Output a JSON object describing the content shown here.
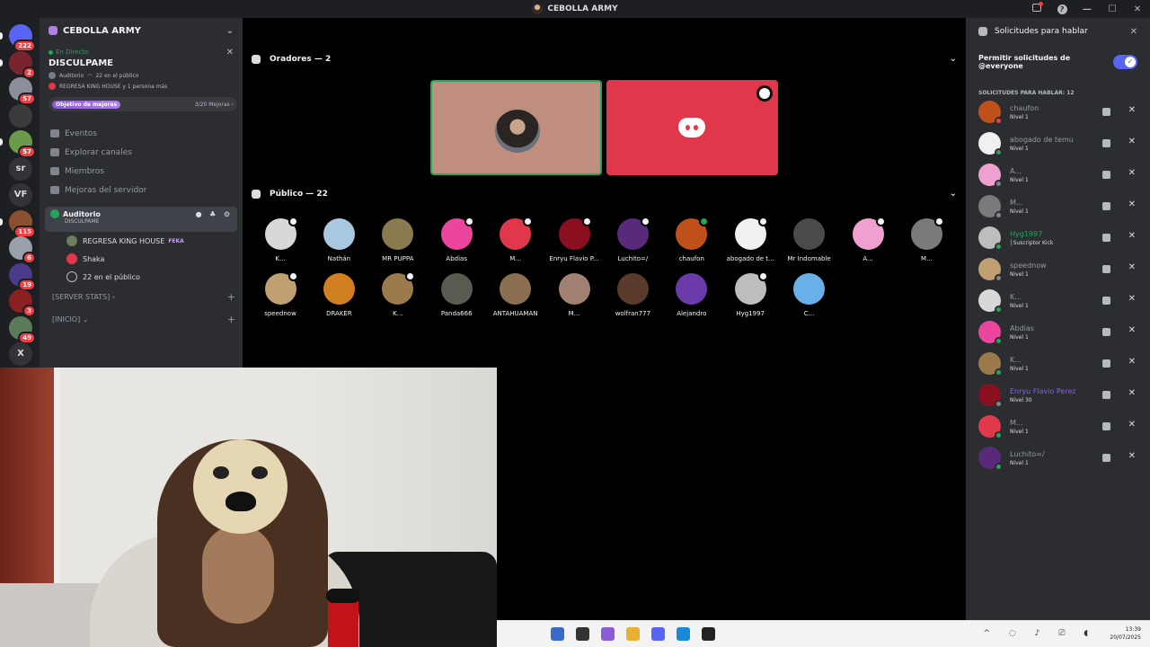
{
  "window": {
    "title": "CEBOLLA ARMY"
  },
  "rail": [
    {
      "badge": "222",
      "color": "#5865f2"
    },
    {
      "badge": "2",
      "color": "#7a2430"
    },
    {
      "badge": "57",
      "color": "#8a8f99"
    },
    {
      "badge": "",
      "color": "#3a3a3a"
    },
    {
      "badge": "57",
      "color": "#6a9a4a"
    },
    {
      "text": "sr"
    },
    {
      "text": "VF"
    },
    {
      "badge": "115",
      "color": "#8a5030"
    },
    {
      "badge": "6",
      "color": "#9aa0aa"
    },
    {
      "badge": "19",
      "color": "#4a3a8a"
    },
    {
      "badge": "3",
      "color": "#8a2020"
    },
    {
      "badge": "49",
      "color": "#5a7a5a"
    },
    {
      "text": "X"
    }
  ],
  "sidebar": {
    "server_name": "CEBOLLA ARMY",
    "live_label": "En Directo",
    "live_title": "DISCULPAME",
    "live_meta1_a": "Auditorio",
    "live_meta1_b": "22 en el público",
    "live_meta2": "REGRESA KING HOUSE y 1 persona más",
    "boost_label": "Objetivo de mejoras",
    "boost_value": "3/20 Mejoras ›",
    "nav": [
      "Eventos",
      "Explorar canales",
      "Miembros",
      "Mejoras del servidor"
    ],
    "voice_channel": {
      "name": "Auditorio",
      "subtitle": "DISCULPAME"
    },
    "voice_members": [
      {
        "name": "REGRESA KING HOUSE",
        "tag": "FEKA"
      },
      {
        "name": "Shaka",
        "tag": ""
      },
      {
        "name": "22 en el público",
        "tag": ""
      }
    ],
    "categories": [
      "[SERVER STATS] ›",
      "[INICIO] ⌄"
    ]
  },
  "stage": {
    "speakers_title": "Oradores — 2",
    "audience_title": "Público — 22",
    "audience": [
      {
        "name": "K...",
        "color": "#d8d8d8",
        "badge": true
      },
      {
        "name": "Nathán",
        "color": "#a8c8e0",
        "badge": false
      },
      {
        "name": "MR PUPPA",
        "color": "#8a7a50",
        "badge": false
      },
      {
        "name": "Abdias",
        "color": "#eb459e",
        "badge": true
      },
      {
        "name": "M...",
        "color": "#e0384a",
        "badge": true
      },
      {
        "name": "Enryu Flavio P...",
        "color": "#8a1020",
        "badge": true
      },
      {
        "name": "Luchito=/",
        "color": "#5a2a7a",
        "badge": true
      },
      {
        "name": "chaufon",
        "color": "#c0501a",
        "badge": "green"
      },
      {
        "name": "abogado de t...",
        "color": "#f0f0f0",
        "badge": true
      },
      {
        "name": "Mr Indomable",
        "color": "#4a4a4a",
        "badge": false
      },
      {
        "name": "A...",
        "color": "#f0a0d0",
        "badge": true
      },
      {
        "name": "M...",
        "color": "#7a7a7a",
        "badge": true
      },
      {
        "name": "speednow",
        "color": "#c0a070",
        "badge": true
      },
      {
        "name": "DRAKER",
        "color": "#d08020",
        "badge": false
      },
      {
        "name": "K...",
        "color": "#9a7a4a",
        "badge": true
      },
      {
        "name": "Panda666",
        "color": "#5a5a50",
        "badge": false
      },
      {
        "name": "ANTAHUAMAN",
        "color": "#8a7050",
        "badge": false
      },
      {
        "name": "M...",
        "color": "#a08070",
        "badge": false
      },
      {
        "name": "wolfran777",
        "color": "#5a3a2a",
        "badge": false
      },
      {
        "name": "Alejandro",
        "color": "#6a3aaa",
        "badge": false
      },
      {
        "name": "Hyg1997",
        "color": "#bdbdbd",
        "badge": true
      },
      {
        "name": "C...",
        "color": "#6ab0e8",
        "badge": false
      }
    ]
  },
  "requests": {
    "title": "Solicitudes para hablar",
    "permit_label": "Permitir solicitudes de @everyone",
    "list_title": "SOLICITUDES PARA HABLAR: 12",
    "items": [
      {
        "name": "chaufon",
        "level": "Nivel 1",
        "color": "#c0501a",
        "status": "dnd"
      },
      {
        "name": "abogado de temu",
        "level": "Nivel 1",
        "color": "#f0f0f0",
        "status": "on"
      },
      {
        "name": "A...",
        "level": "Nivel 1",
        "color": "#f0a0d0",
        "status": "off"
      },
      {
        "name": "M...",
        "level": "Nivel 1",
        "color": "#7a7a7a",
        "status": "off"
      },
      {
        "name": "Hyg1997",
        "level": "│Suscriptor Kick",
        "color": "#bdbdbd",
        "status": "on",
        "nameColor": "#23a55a"
      },
      {
        "name": "speednow",
        "level": "Nivel 1",
        "color": "#c0a070",
        "status": "off"
      },
      {
        "name": "K...",
        "level": "Nivel 1",
        "color": "#d8d8d8",
        "status": "on"
      },
      {
        "name": "Abdias",
        "level": "Nivel 1",
        "color": "#eb459e",
        "status": "on"
      },
      {
        "name": "K...",
        "level": "Nivel 1",
        "color": "#9a7a4a",
        "status": "on"
      },
      {
        "name": "Enryu Flavio Perez",
        "level": "Nivel 30",
        "color": "#8a1020",
        "status": "off",
        "nameColor": "#8a5cf0"
      },
      {
        "name": "M...",
        "level": "Nivel 1",
        "color": "#e0384a",
        "status": "on"
      },
      {
        "name": "Luchito=/",
        "level": "Nivel 1",
        "color": "#5a2a7a",
        "status": "on"
      }
    ]
  },
  "taskbar": {
    "time": "13:39",
    "date": "20/07/2025",
    "icons": [
      "#3a6ac8",
      "#333333",
      "#8a5cd6",
      "#e8b030",
      "#5865f2",
      "#1a8ad8",
      "#222222"
    ]
  }
}
